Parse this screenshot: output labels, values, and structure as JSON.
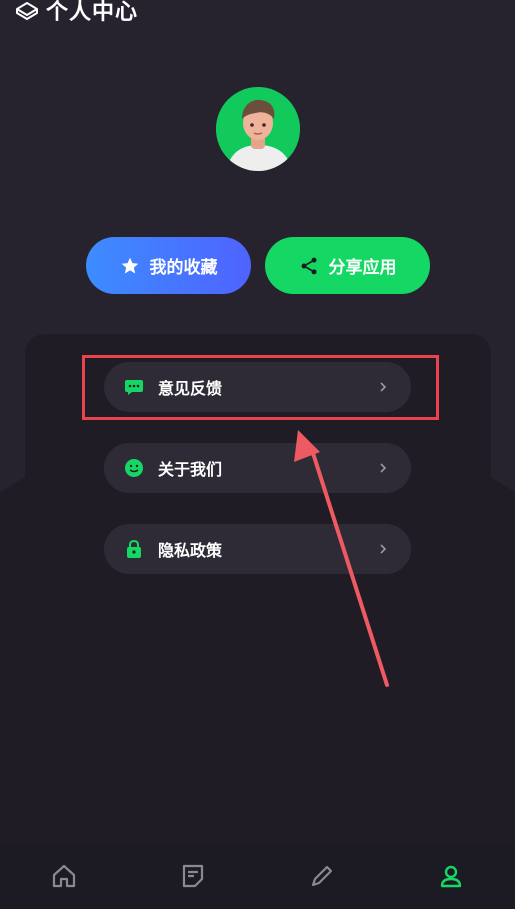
{
  "header": {
    "title": "个人中心",
    "icon": "book-icon"
  },
  "profile": {
    "avatar": "user-avatar"
  },
  "actions": {
    "favorites_label": "我的收藏",
    "share_label": "分享应用"
  },
  "menu": {
    "items": [
      {
        "label": "意见反馈",
        "icon": "message-icon"
      },
      {
        "label": "关于我们",
        "icon": "smile-icon"
      },
      {
        "label": "隐私政策",
        "icon": "lock-icon"
      }
    ]
  },
  "tabbar": {
    "items": [
      {
        "icon": "home-icon",
        "active": false
      },
      {
        "icon": "note-icon",
        "active": false
      },
      {
        "icon": "pencil-icon",
        "active": false
      },
      {
        "icon": "user-icon",
        "active": true
      }
    ]
  },
  "colors": {
    "background": "#26232f",
    "accent_green": "#14d863",
    "accent_blue": "#4f63ff",
    "highlight_red": "#e9444d"
  }
}
